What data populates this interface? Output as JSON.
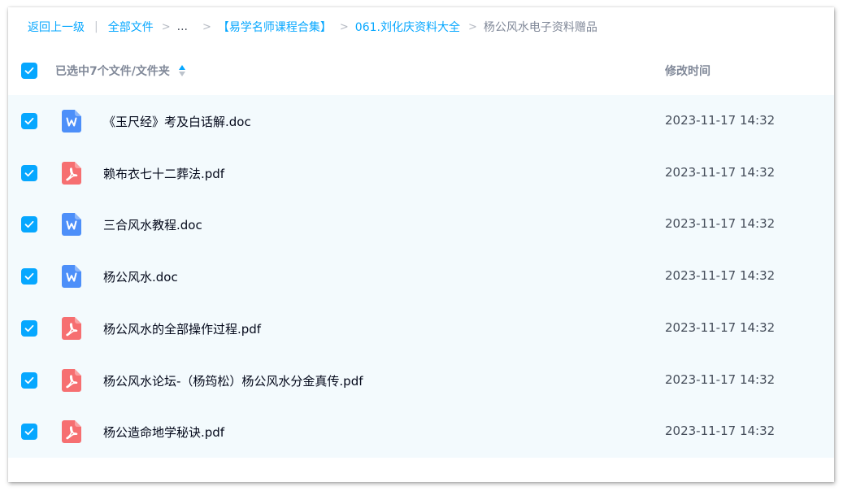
{
  "breadcrumb": {
    "back": "返回上一级",
    "all_files": "全部文件",
    "ellipsis": "...",
    "folder1": "【易学名师课程合集】",
    "folder2": "061.刘化庆资料大全",
    "current": "杨公风水电子资料赠品"
  },
  "header": {
    "selected_label": "已选中7个文件/文件夹",
    "time_label": "修改时间",
    "all_checked": true
  },
  "colors": {
    "accent": "#06a7ff",
    "doc_icon": "#4d8ff9",
    "pdf_icon": "#f66f71",
    "row_bg": "#f3fafd"
  },
  "files": [
    {
      "name": "《玉尺经》考及白话解.doc",
      "time": "2023-11-17 14:32",
      "icon": "word-icon",
      "checked": true
    },
    {
      "name": "赖布衣七十二葬法.pdf",
      "time": "2023-11-17 14:32",
      "icon": "pdf-icon",
      "checked": true
    },
    {
      "name": "三合风水教程.doc",
      "time": "2023-11-17 14:32",
      "icon": "word-icon",
      "checked": true
    },
    {
      "name": "杨公风水.doc",
      "time": "2023-11-17 14:32",
      "icon": "word-icon",
      "checked": true
    },
    {
      "name": "杨公风水的全部操作过程.pdf",
      "time": "2023-11-17 14:32",
      "icon": "pdf-icon",
      "checked": true
    },
    {
      "name": "杨公风水论坛-（杨筠松）杨公风水分金真传.pdf",
      "time": "2023-11-17 14:32",
      "icon": "pdf-icon",
      "checked": true
    },
    {
      "name": "杨公造命地学秘诀.pdf",
      "time": "2023-11-17 14:32",
      "icon": "pdf-icon",
      "checked": true
    }
  ]
}
